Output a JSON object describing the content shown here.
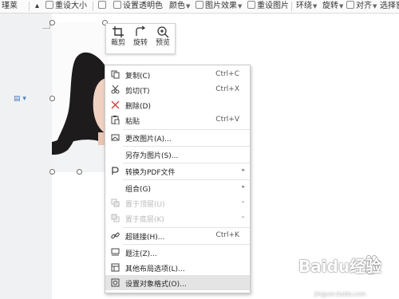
{
  "ribbon": {
    "font_fragment": "瑾莱",
    "reset_size": "重设大小",
    "set_transparent": "设置透明色",
    "color": "颜色",
    "picture_effect": "图片效果",
    "reset_picture": "重设图片",
    "wrap": "环绕",
    "rotate": "旋转",
    "align": "对齐",
    "select_pane": "选择窗"
  },
  "mini_toolbar": {
    "crop": "裁剪",
    "rotate": "旋转",
    "preview": "预览"
  },
  "context_menu": {
    "items": [
      {
        "label": "复制(C)",
        "shortcut": "Ctrl+C",
        "icon": "copy-icon"
      },
      {
        "label": "剪切(T)",
        "shortcut": "Ctrl+X",
        "icon": "scissors-icon"
      },
      {
        "label": "删除(D)",
        "shortcut": "",
        "icon": "delete-x-icon"
      },
      {
        "label": "粘贴",
        "shortcut": "Ctrl+V",
        "icon": "paste-icon"
      },
      {
        "label": "更改图片(A)...",
        "shortcut": "",
        "icon": "change-picture-icon"
      },
      {
        "label": "另存为图片(S)...",
        "shortcut": "",
        "icon": ""
      },
      {
        "label": "转换为PDF文件",
        "shortcut": "",
        "icon": "pdf-icon"
      },
      {
        "label": "组合(G)",
        "shortcut": "",
        "icon": ""
      },
      {
        "label": "置于顶层(U)",
        "shortcut": "",
        "icon": "bring-to-front-icon"
      },
      {
        "label": "置于底层(K)",
        "shortcut": "",
        "icon": "send-to-back-icon"
      },
      {
        "label": "超链接(H)...",
        "shortcut": "Ctrl+K",
        "icon": "hyperlink-icon"
      },
      {
        "label": "题注(Z)...",
        "shortcut": "",
        "icon": "caption-icon"
      },
      {
        "label": "其他布局选项(L)...",
        "shortcut": "",
        "icon": "layout-options-icon"
      },
      {
        "label": "设置对象格式(O)...",
        "shortcut": "",
        "icon": "format-object-icon"
      }
    ]
  },
  "watermark": {
    "brand": "Baidu经验",
    "sub": "jingyan.baidu.com"
  },
  "colors": {
    "accent": "#4a7fc0",
    "menu_highlight": "#e4e4e4",
    "disabled": "#b9b9b9"
  }
}
